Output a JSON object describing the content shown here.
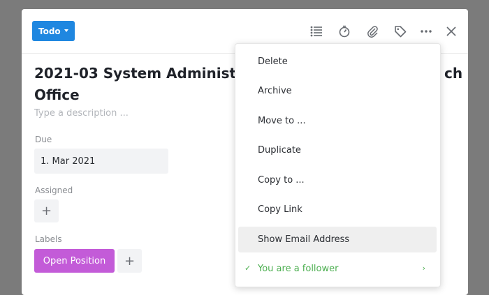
{
  "header": {
    "status_label": "Todo",
    "icons": [
      "checklist-icon",
      "timer-icon",
      "attachment-icon",
      "tag-icon",
      "more-icon",
      "close-icon"
    ]
  },
  "card": {
    "title_line1": "2021-03 System Administrat",
    "title_tail": "ch",
    "title_line2": "Office",
    "description_placeholder": "Type a description ...",
    "due_label": "Due",
    "due_value": "1. Mar 2021",
    "assigned_label": "Assigned",
    "labels_label": "Labels",
    "label_chip": "Open Position",
    "add_symbol": "+",
    "colors": {
      "accent": "#1f87e0",
      "label_chip": "#c35bd8",
      "follow": "#4caf50"
    }
  },
  "menu": {
    "items": [
      {
        "label": "Delete"
      },
      {
        "label": "Archive"
      },
      {
        "label": "Move to ..."
      },
      {
        "label": "Duplicate"
      },
      {
        "label": "Copy to ..."
      },
      {
        "label": "Copy Link"
      },
      {
        "label": "Show Email Address"
      }
    ],
    "follow_label": "You are a follower",
    "check_symbol": "✓",
    "chevron_symbol": "›"
  }
}
